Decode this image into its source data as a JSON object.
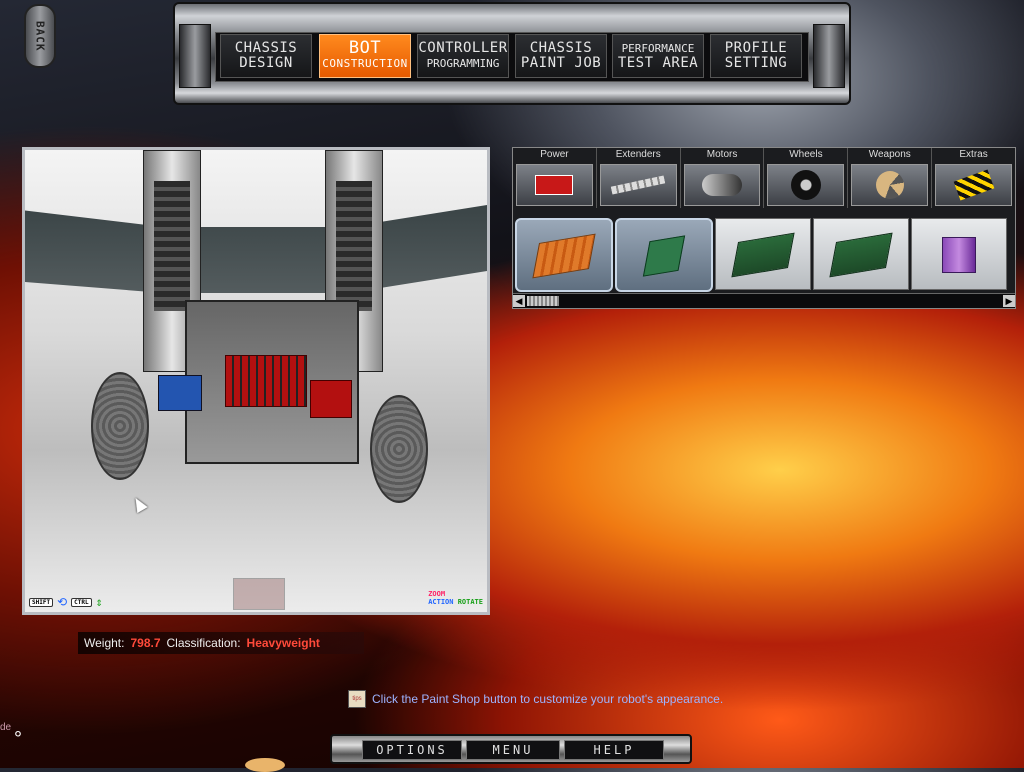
{
  "back": {
    "label": "BACK"
  },
  "tabs": [
    {
      "line1": "CHASSIS",
      "line2": "DESIGN",
      "active": false
    },
    {
      "line1": "BOT",
      "line2": "CONSTRUCTION",
      "active": true
    },
    {
      "line1": "CONTROLLER",
      "line2": "PROGRAMMING",
      "active": false
    },
    {
      "line1": "CHASSIS",
      "line2": "PAINT JOB",
      "active": false
    },
    {
      "line1": "PERFORMANCE",
      "line2": "TEST AREA",
      "active": false
    },
    {
      "line1": "PROFILE",
      "line2": "SETTING",
      "active": false
    }
  ],
  "viewport": {
    "hud": {
      "shift": "SHIFT",
      "ctrl": "CTRL",
      "action": "ACTION",
      "zoom": "ZOOM",
      "rotate": "ROTATE"
    }
  },
  "stats": {
    "weight_label": "Weight:",
    "weight_value": "798.7",
    "class_label": "Classification:",
    "class_value": "Heavyweight"
  },
  "parts_panel": {
    "categories": [
      {
        "label": "Power",
        "icon": "battery-icon"
      },
      {
        "label": "Extenders",
        "icon": "extender-bar-icon"
      },
      {
        "label": "Motors",
        "icon": "motor-icon"
      },
      {
        "label": "Wheels",
        "icon": "wheel-icon"
      },
      {
        "label": "Weapons",
        "icon": "saw-blade-icon"
      },
      {
        "label": "Extras",
        "icon": "hazard-plate-icon"
      }
    ],
    "items": [
      {
        "icon": "orange-controller-board-icon",
        "selected": true
      },
      {
        "icon": "green-receiver-board-icon",
        "selected": true
      },
      {
        "icon": "green-circuit-board-icon",
        "selected": false
      },
      {
        "icon": "green-circuit-board-icon",
        "selected": false
      },
      {
        "icon": "purple-battery-pack-icon",
        "selected": false
      }
    ]
  },
  "tip": {
    "icon_text": "tips",
    "text": "Click the Paint Shop button to customize your robot's appearance."
  },
  "bottom_menu": {
    "options": "OPTIONS",
    "menu": "MENU",
    "help": "HELP"
  },
  "colors": {
    "accent": "#ff7a10",
    "stat_value": "#ff4a3a",
    "tip_text": "#9db4ff"
  }
}
